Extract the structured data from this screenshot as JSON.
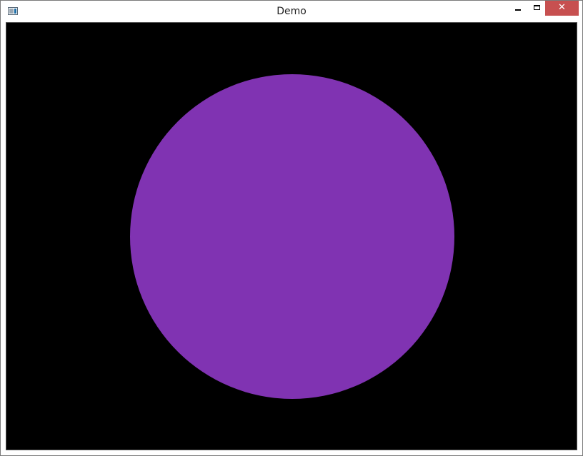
{
  "window": {
    "title": "Demo"
  },
  "icons": {
    "app": "app-window-icon",
    "minimize": "minimize-icon",
    "maximize": "maximize-icon",
    "close": "close-icon"
  },
  "controls": {
    "close_glyph": "✕"
  },
  "canvas": {
    "background": "#000000",
    "shape": "circle",
    "shape_color": "#8033b2"
  }
}
